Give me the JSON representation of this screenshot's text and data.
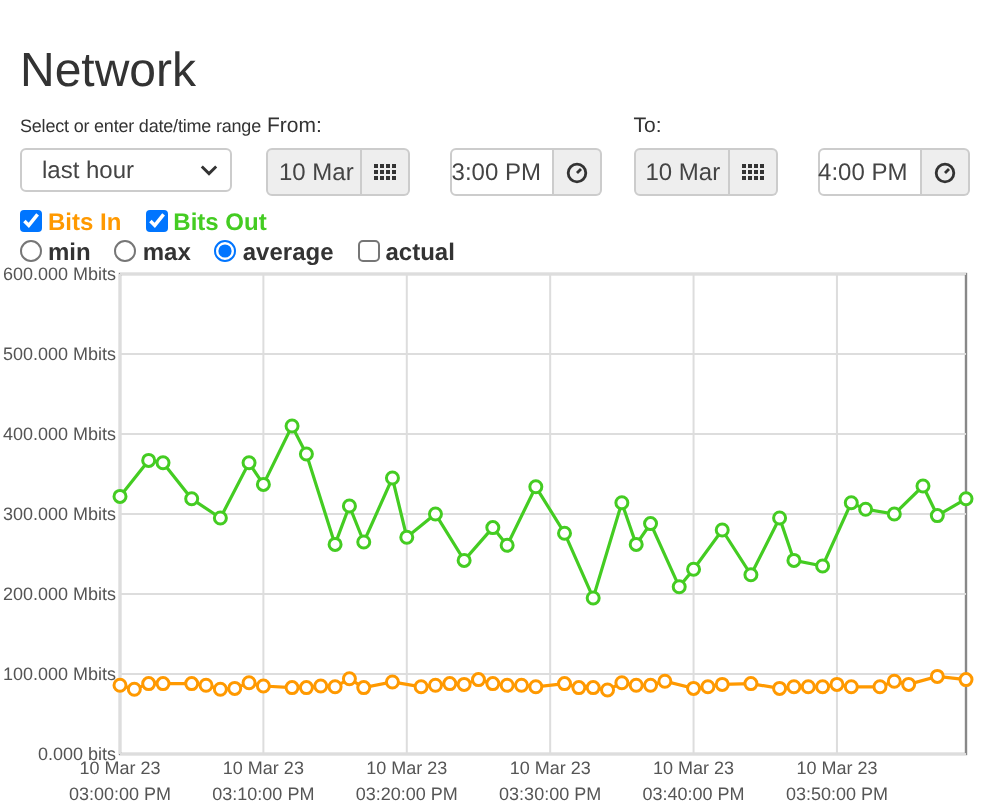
{
  "title": "Network",
  "range": {
    "label": "Select or enter date/time range",
    "value": "last hour"
  },
  "from": {
    "label": "From:",
    "date": "10 Mar",
    "date_readonly": true,
    "time": "3:00 PM"
  },
  "to": {
    "label": "To:",
    "date": "10 Mar",
    "date_readonly": true,
    "time": "4:00 PM"
  },
  "series_toggles": [
    {
      "checked": true
    },
    {
      "checked": true
    }
  ],
  "modes": [
    {
      "kind": "radio",
      "label": "min",
      "selected": false
    },
    {
      "kind": "radio",
      "label": "max",
      "selected": false
    },
    {
      "kind": "radio",
      "label": "average",
      "selected": true
    },
    {
      "kind": "checkbox",
      "label": "actual",
      "checked": false
    }
  ],
  "chart": {
    "chart_data": {
      "type": "line",
      "grid": true,
      "categories": [
        "10 Mar 23\n03:00:00 PM",
        null,
        null,
        null,
        null,
        null,
        null,
        null,
        null,
        null,
        "10 Mar 23\n03:10:00 PM",
        null,
        null,
        null,
        null,
        null,
        null,
        null,
        null,
        null,
        "10 Mar 23\n03:20:00 PM",
        null,
        null,
        null,
        null,
        null,
        null,
        null,
        null,
        null,
        "10 Mar 23\n03:30:00 PM",
        null,
        null,
        null,
        null,
        null,
        null,
        null,
        null,
        null,
        "10 Mar 23\n03:40:00 PM",
        null,
        null,
        null,
        null,
        null,
        null,
        null,
        null,
        null,
        "10 Mar 23\n03:50:00 PM",
        null,
        null,
        null,
        null,
        null,
        null,
        null,
        null,
        null
      ],
      "ylim": [
        0,
        600
      ],
      "yticks": [
        {
          "value": 0,
          "label": "0.000 bits"
        },
        {
          "value": 100,
          "label": "100.000 Mbits"
        },
        {
          "value": 200,
          "label": "200.000 Mbits"
        },
        {
          "value": 300,
          "label": "300.000 Mbits"
        },
        {
          "value": 400,
          "label": "400.000 Mbits"
        },
        {
          "value": 500,
          "label": "500.000 Mbits"
        },
        {
          "value": 600,
          "label": "600.000 Mbits"
        }
      ],
      "series": [
        {
          "name": "Bits In",
          "color": "#ff9900",
          "marker": "circle",
          "values": [
            86,
            81,
            88,
            88,
            null,
            88,
            86,
            81,
            82,
            89,
            85,
            null,
            83,
            83,
            85,
            84,
            94,
            83,
            null,
            90,
            null,
            84,
            86,
            88,
            87,
            93,
            88,
            86,
            86,
            84,
            null,
            88,
            83,
            83,
            80,
            89,
            86,
            86,
            91,
            null,
            82,
            84,
            87,
            null,
            88,
            null,
            82,
            84,
            84,
            84,
            87,
            84,
            null,
            84,
            91,
            87,
            null,
            97,
            null,
            93
          ]
        },
        {
          "name": "Bits Out",
          "color": "#44cc22",
          "marker": "circle",
          "values": [
            322,
            null,
            367,
            364,
            null,
            319,
            null,
            295,
            null,
            364,
            337,
            null,
            410,
            375,
            null,
            262,
            310,
            265,
            null,
            345,
            271,
            null,
            300,
            null,
            242,
            null,
            283,
            261,
            null,
            334,
            null,
            276,
            null,
            195,
            null,
            314,
            262,
            288,
            null,
            209,
            231,
            null,
            280,
            null,
            224,
            null,
            295,
            242,
            null,
            235,
            null,
            314,
            306,
            null,
            300,
            null,
            335,
            298,
            null,
            319
          ]
        }
      ]
    }
  }
}
